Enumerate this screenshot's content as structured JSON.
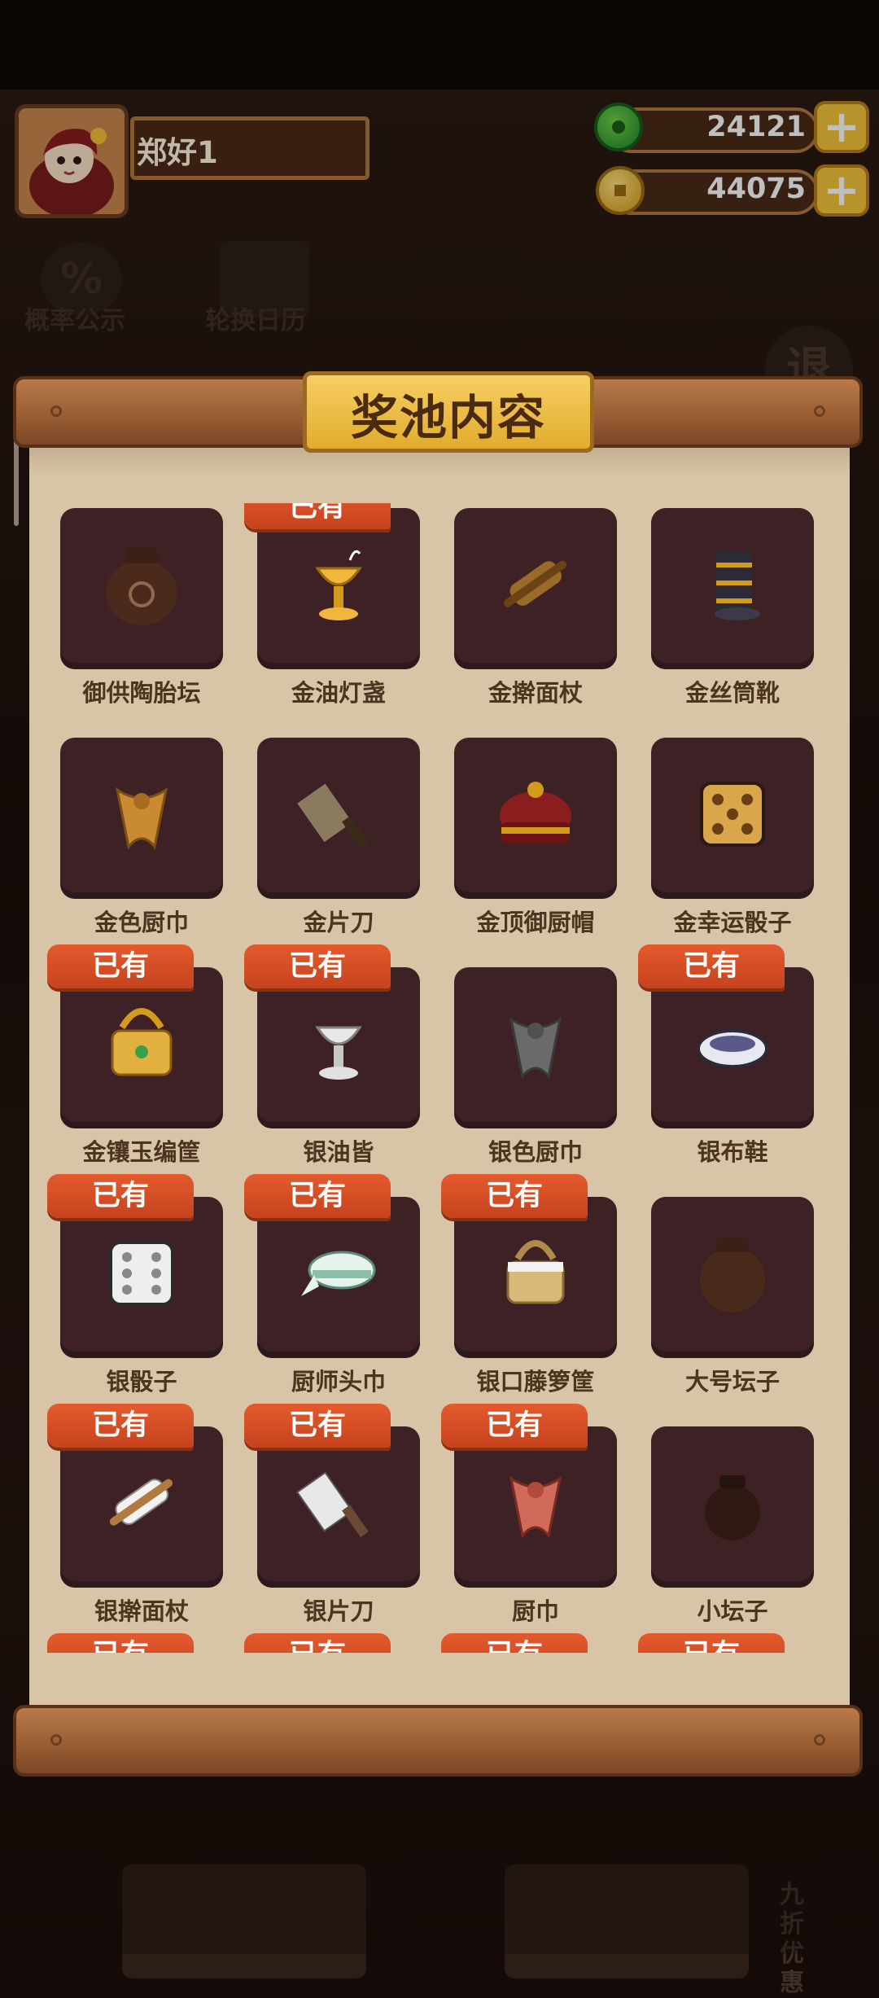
{
  "player": {
    "name": "郑好1"
  },
  "currencies": [
    {
      "name": "jade",
      "value": "24121"
    },
    {
      "name": "coin",
      "value": "44075"
    }
  ],
  "background": {
    "left_buttons": [
      "概率公示",
      "轮换日历"
    ],
    "right_button": "退",
    "bottom_side_tab": "九折优惠"
  },
  "dialog": {
    "title": "奖池内容",
    "owned_label": "已有",
    "items": [
      {
        "name": "御供陶胎坛",
        "owned": false,
        "icon": "clay-jar-icon"
      },
      {
        "name": "金油灯盏",
        "owned": true,
        "icon": "gold-oil-lamp-icon"
      },
      {
        "name": "金擀面杖",
        "owned": false,
        "icon": "gold-rolling-pin-icon"
      },
      {
        "name": "金丝筒靴",
        "owned": false,
        "icon": "gold-boot-icon"
      },
      {
        "name": "金色厨巾",
        "owned": false,
        "icon": "gold-scarf-icon"
      },
      {
        "name": "金片刀",
        "owned": false,
        "icon": "gold-cleaver-icon"
      },
      {
        "name": "金顶御厨帽",
        "owned": false,
        "icon": "gold-chef-hat-icon"
      },
      {
        "name": "金幸运骰子",
        "owned": false,
        "icon": "gold-dice-icon"
      },
      {
        "name": "金镶玉编筐",
        "owned": true,
        "icon": "gold-basket-icon"
      },
      {
        "name": "银油皆",
        "owned": true,
        "icon": "silver-lamp-icon"
      },
      {
        "name": "银色厨巾",
        "owned": false,
        "icon": "silver-scarf-icon"
      },
      {
        "name": "银布鞋",
        "owned": true,
        "icon": "silver-shoe-icon"
      },
      {
        "name": "银骰子",
        "owned": true,
        "icon": "silver-dice-icon"
      },
      {
        "name": "厨师头巾",
        "owned": true,
        "icon": "chef-headscarf-icon"
      },
      {
        "name": "银口藤箩筐",
        "owned": true,
        "icon": "rattan-basket-icon"
      },
      {
        "name": "大号坛子",
        "owned": false,
        "icon": "large-jar-icon"
      },
      {
        "name": "银擀面杖",
        "owned": true,
        "icon": "silver-rolling-pin-icon"
      },
      {
        "name": "银片刀",
        "owned": true,
        "icon": "silver-cleaver-icon"
      },
      {
        "name": "厨巾",
        "owned": true,
        "icon": "scarf-icon"
      },
      {
        "name": "小坛子",
        "owned": false,
        "icon": "small-jar-icon"
      }
    ],
    "next_row_owned": [
      true,
      true,
      true,
      true
    ]
  },
  "colors": {
    "owned_badge": "#d94d25",
    "tile": "#3d2124",
    "paper": "#d8c4a7",
    "title_plate": "#f0c04a"
  }
}
